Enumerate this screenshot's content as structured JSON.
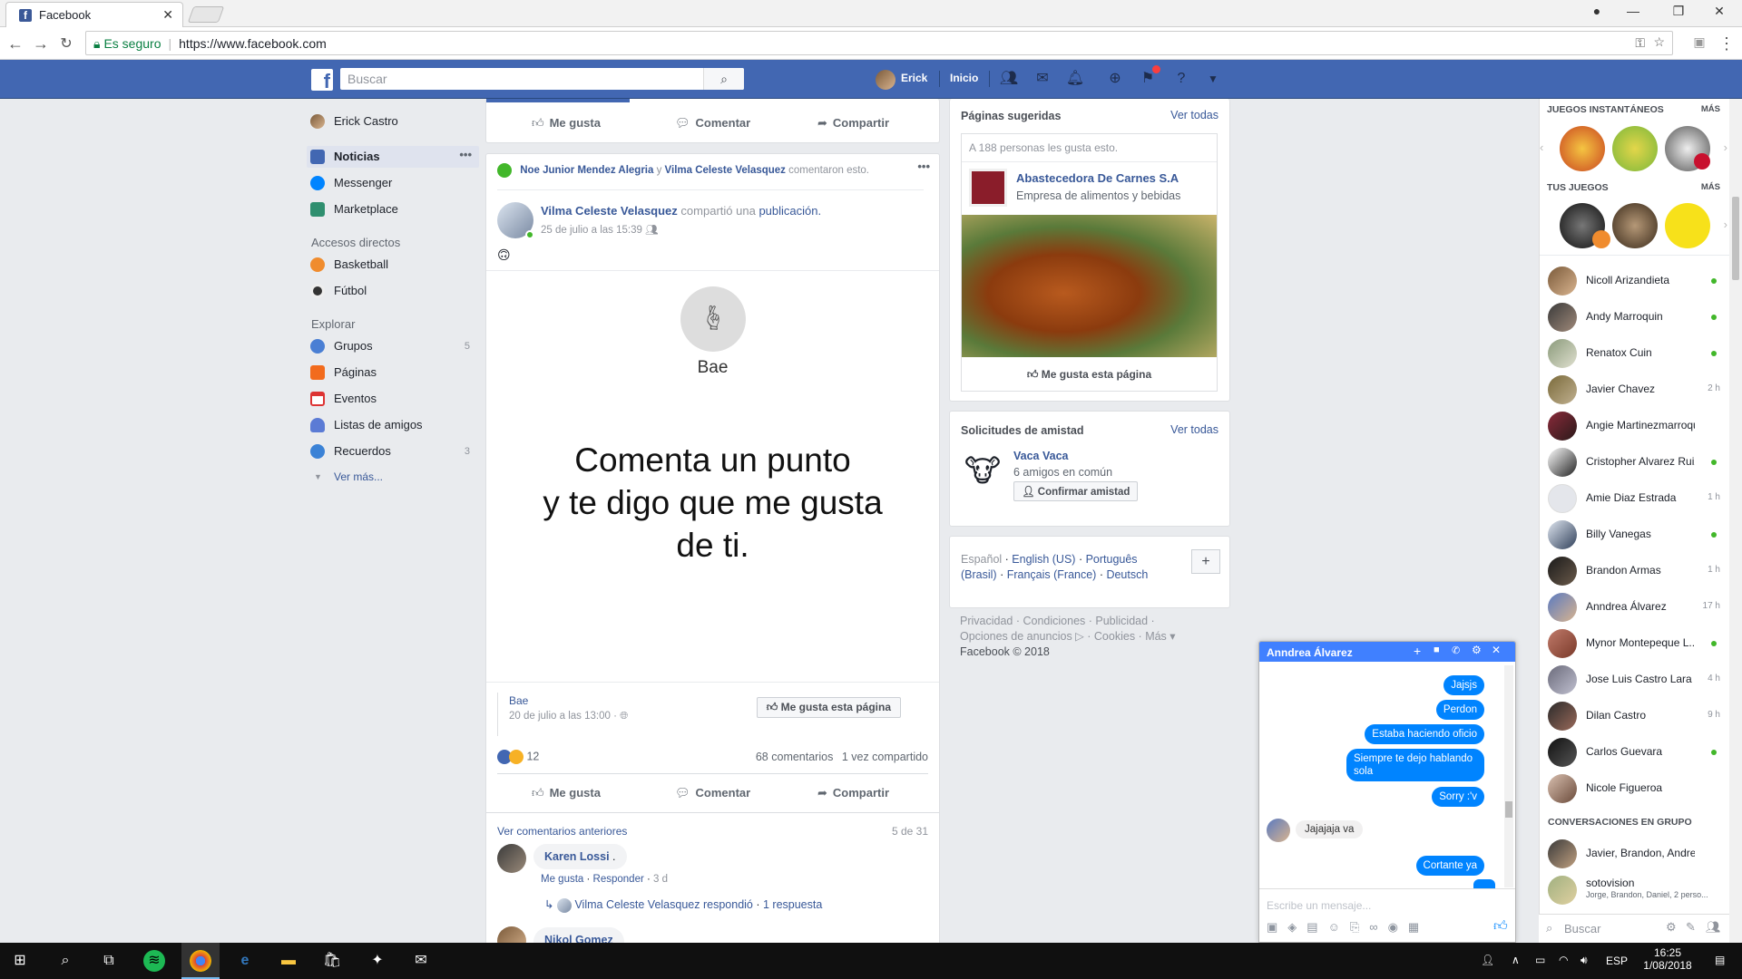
{
  "browser": {
    "tab_title": "Facebook",
    "secure_label": "Es seguro",
    "url": "https://www.facebook.com"
  },
  "header": {
    "search_placeholder": "Buscar",
    "user_name": "Erick",
    "home_label": "Inicio"
  },
  "left_nav": {
    "profile_name": "Erick Castro",
    "items": [
      {
        "label": "Noticias"
      },
      {
        "label": "Messenger"
      },
      {
        "label": "Marketplace"
      }
    ],
    "shortcuts_title": "Accesos directos",
    "shortcuts": [
      {
        "label": "Basketball"
      },
      {
        "label": "Fútbol"
      }
    ],
    "explore_title": "Explorar",
    "explore": [
      {
        "label": "Grupos",
        "count": "5"
      },
      {
        "label": "Páginas",
        "count": ""
      },
      {
        "label": "Eventos",
        "count": ""
      },
      {
        "label": "Listas de amigos",
        "count": ""
      },
      {
        "label": "Recuerdos",
        "count": "3"
      }
    ],
    "more_label": "Ver más..."
  },
  "post_actions": {
    "like": "Me gusta",
    "comment": "Comentar",
    "share": "Compartir"
  },
  "post": {
    "activity_user1": "Noe Junior Mendez Alegria",
    "activity_and": "y",
    "activity_user2": "Vilma Celeste Velasquez",
    "activity_text": "comentaron esto.",
    "author": "Vilma Celeste Velasquez",
    "shared_text": "compartió una",
    "shared_link": "publicación.",
    "date": "25 de julio a las 15:39",
    "image_page_name": "Bae",
    "image_line1": "Comenta un punto",
    "image_line2": "y te digo que me gusta",
    "image_line3": "de ti.",
    "source_page": "Bae",
    "source_date": "20 de julio a las 13:00",
    "like_page_button": "Me gusta esta página",
    "reactions_count": "12",
    "comments_count": "68 comentarios",
    "shares_count": "1 vez compartido",
    "view_prev_comments": "Ver comentarios anteriores",
    "comments_position": "5 de 31",
    "comment1_author": "Karen Lossi",
    "comment1_text": ".",
    "comment1_like": "Me gusta",
    "comment1_reply": "Responder",
    "comment1_time": "3 d",
    "reply_author": "Vilma Celeste Velasquez",
    "reply_text": "respondió",
    "reply_count": "1 respuesta",
    "comment2_author": "Nikol Gomez"
  },
  "suggested_pages": {
    "title": "Páginas sugeridas",
    "see_all": "Ver todas",
    "likes_text": "A 188 personas les gusta esto.",
    "page_name": "Abastecedora De Carnes S.A",
    "page_category": "Empresa de alimentos y bebidas",
    "like_button": "Me gusta esta página"
  },
  "friend_requests": {
    "title": "Solicitudes de amistad",
    "see_all": "Ver todas",
    "name": "Vaca Vaca",
    "mutual": "6 amigos en común",
    "confirm": "Confirmar amistad"
  },
  "languages": {
    "current": "Español",
    "items": [
      "English (US)",
      "Português (Brasil)",
      "Français (France)",
      "Deutsch"
    ]
  },
  "footer": {
    "links": [
      "Privacidad",
      "Condiciones",
      "Publicidad",
      "Opciones de anuncios",
      "Cookies",
      "Más"
    ],
    "copyright": "Facebook © 2018"
  },
  "chat_sidebar": {
    "instant_games_title": "JUEGOS INSTANTÁNEOS",
    "more": "MÁS",
    "your_games_title": "TUS JUEGOS",
    "contacts": [
      {
        "name": "Nicoll Arizandieta",
        "status": ""
      },
      {
        "name": "Andy Marroquin",
        "status": ""
      },
      {
        "name": "Renatox Cuin",
        "status": ""
      },
      {
        "name": "Javier Chavez",
        "status": "2 h"
      },
      {
        "name": "Angie Martinezmarroquin",
        "status": ""
      },
      {
        "name": "Cristopher Alvarez Ruiz",
        "status": ""
      },
      {
        "name": "Amie Diaz Estrada",
        "status": "1 h"
      },
      {
        "name": "Billy Vanegas",
        "status": ""
      },
      {
        "name": "Brandon Armas",
        "status": "1 h"
      },
      {
        "name": "Anndrea Álvarez",
        "status": "17 h"
      },
      {
        "name": "Mynor Montepeque L...",
        "status": ""
      },
      {
        "name": "Jose Luis Castro Lara",
        "status": "4 h"
      },
      {
        "name": "Dilan Castro",
        "status": "9 h"
      },
      {
        "name": "Carlos Guevara",
        "status": ""
      },
      {
        "name": "Nicole Figueroa",
        "status": ""
      }
    ],
    "group_title": "CONVERSACIONES EN GRUPO",
    "group1": "Javier, Brandon, Andres",
    "group2_name": "sotovision",
    "group2_members": "Jorge, Brandon, Daniel, 2 perso...",
    "search_placeholder": "Buscar"
  },
  "messenger": {
    "contact": "Anndrea Álvarez",
    "messages_sent": [
      "Jajsjs",
      "Perdon",
      "Estaba haciendo oficio",
      "Siempre te dejo hablando sola",
      "Sorry :'v"
    ],
    "message_received": "Jajajaja va",
    "message_last": "Cortante ya",
    "input_placeholder": "Escribe un mensaje..."
  },
  "taskbar": {
    "lang": "ESP",
    "time": "16:25",
    "date": "1/08/2018"
  }
}
